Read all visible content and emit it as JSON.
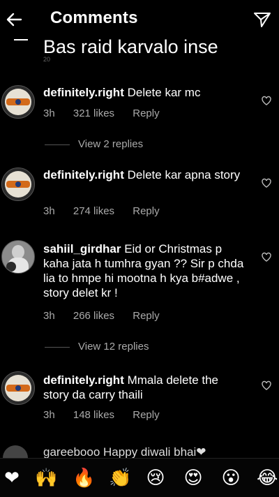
{
  "header": {
    "title": "Comments",
    "caption": "Bas raid karvalo inse",
    "tiny_number": "20"
  },
  "comments": [
    {
      "username": "definitely.right",
      "text": "Delete kar mc",
      "time": "3h",
      "likes": "321 likes",
      "reply": "Reply"
    },
    {
      "username": "definitely.right",
      "text": "Delete kar apna story",
      "time": "3h",
      "likes": "274 likes",
      "reply": "Reply"
    },
    {
      "username": "sahiil_girdhar",
      "text": "Eid or Christmas p kaha jata h tumhra gyan ?? Sir p chda lia to hmpe hi mootna h kya b#adwe , story delet kr !",
      "time": "3h",
      "likes": "266 likes",
      "reply": "Reply"
    },
    {
      "username": "definitely.right",
      "text": "Mmala delete the story da carry thaili",
      "time": "3h",
      "likes": "148 likes",
      "reply": "Reply"
    }
  ],
  "view_replies": [
    {
      "label": "View 2 replies"
    },
    {
      "label": "View 12 replies"
    }
  ],
  "partial_comment": {
    "text": "gareebooo Happy diwali bhai❤"
  },
  "emoji_bar": {
    "items": [
      "❤",
      "🙌",
      "🔥",
      "👏",
      "😢",
      "😍",
      "😮",
      "😂"
    ]
  },
  "colors": {
    "background": "#000000",
    "secondary_text": "#aaaaaa"
  }
}
